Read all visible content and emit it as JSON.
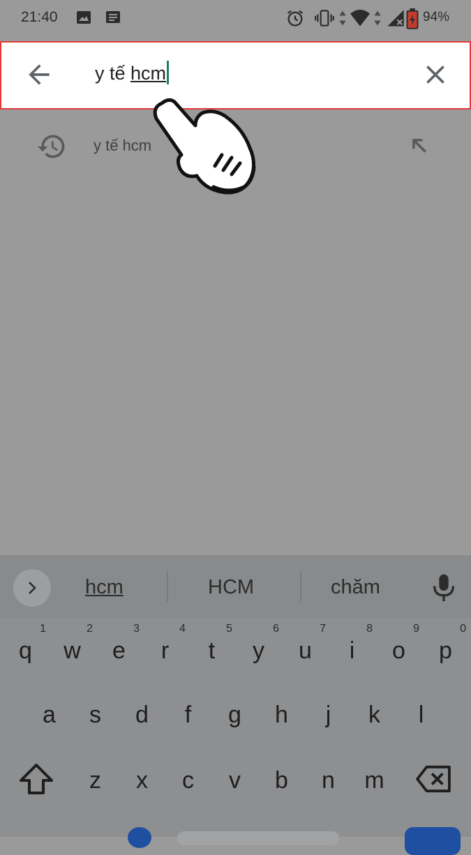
{
  "status_bar": {
    "time": "21:40",
    "battery_percent": "94%",
    "icons": [
      "image-icon",
      "message-icon",
      "alarm-icon",
      "vibrate-icon",
      "data-arrows-icon",
      "wifi-icon",
      "signal-icon",
      "battery-icon"
    ]
  },
  "search": {
    "query_prefix": "y tế ",
    "query_composing": "hcm",
    "back_icon": "arrow-left-icon",
    "clear_icon": "close-icon",
    "highlight_color": "#e53935",
    "caret_color": "#1a7f64"
  },
  "suggestions": [
    {
      "text": "y tế hcm",
      "icon": "history-icon",
      "action_icon": "arrow-up-left-icon"
    }
  ],
  "keyboard": {
    "candidates": [
      "hcm",
      "HCM",
      "chăm"
    ],
    "row1": [
      {
        "key": "q",
        "hint": "1"
      },
      {
        "key": "w",
        "hint": "2"
      },
      {
        "key": "e",
        "hint": "3"
      },
      {
        "key": "r",
        "hint": "4"
      },
      {
        "key": "t",
        "hint": "5"
      },
      {
        "key": "y",
        "hint": "6"
      },
      {
        "key": "u",
        "hint": "7"
      },
      {
        "key": "i",
        "hint": "8"
      },
      {
        "key": "o",
        "hint": "9"
      },
      {
        "key": "p",
        "hint": "0"
      }
    ],
    "row2": [
      "a",
      "s",
      "d",
      "f",
      "g",
      "h",
      "j",
      "k",
      "l"
    ],
    "row3": [
      "z",
      "x",
      "c",
      "v",
      "b",
      "n",
      "m"
    ]
  }
}
